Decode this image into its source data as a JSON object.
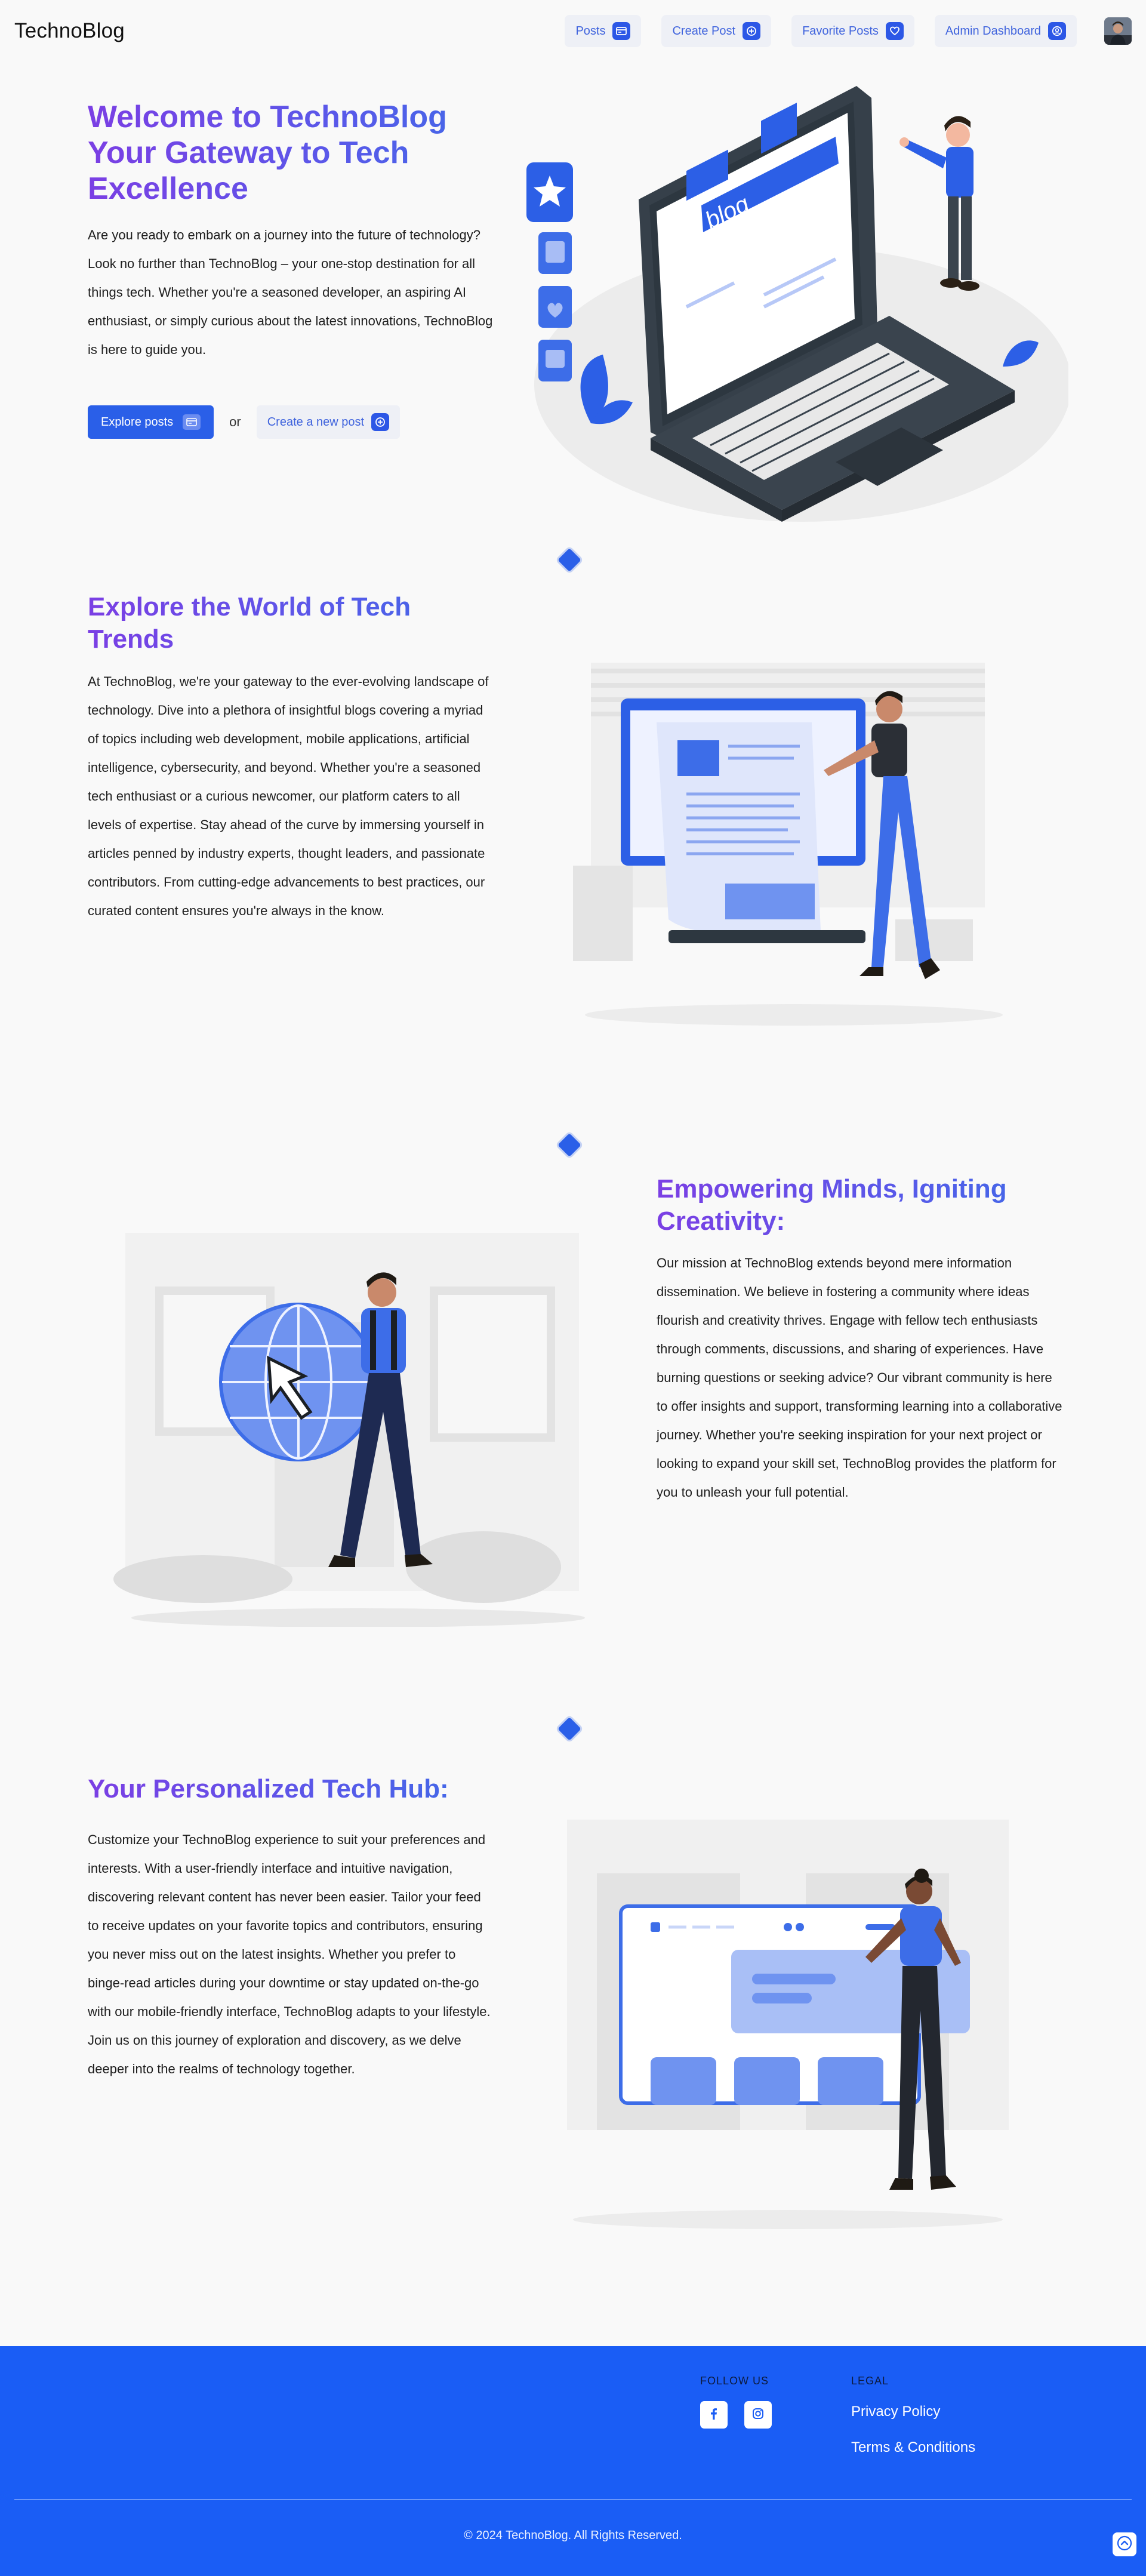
{
  "brand": "TechnoBlog",
  "nav": {
    "posts": "Posts",
    "create_post": "Create Post",
    "favorite_posts": "Favorite Posts",
    "admin_dashboard": "Admin Dashboard"
  },
  "hero": {
    "title_line1": "Welcome to TechnoBlog",
    "title_line2": "Your Gateway to Tech",
    "title_line3": "Excellence",
    "paragraph": "Are you ready to embark on a journey into the future of technology? Look no further than TechnoBlog – your one-stop destination for all things tech. Whether you're a seasoned developer, an aspiring AI enthusiast, or simply curious about the latest innovations, TechnoBlog is here to guide you.",
    "explore_button": "Explore posts",
    "or_text": "or",
    "create_button": "Create a new post",
    "illustration_text": "blog"
  },
  "section2": {
    "title_line1": "Explore the World of Tech",
    "title_line2": "Trends",
    "paragraph": "At TechnoBlog, we're your gateway to the ever-evolving landscape of technology. Dive into a plethora of insightful blogs covering a myriad of topics including web development, mobile applications, artificial intelligence, cybersecurity, and beyond. Whether you're a seasoned tech enthusiast or a curious newcomer, our platform caters to all levels of expertise. Stay ahead of the curve by immersing yourself in articles penned by industry experts, thought leaders, and passionate contributors. From cutting-edge advancements to best practices, our curated content ensures you're always in the know."
  },
  "section3": {
    "title_line1": "Empowering Minds, Igniting",
    "title_line2": "Creativity:",
    "paragraph": "Our mission at TechnoBlog extends beyond mere information dissemination. We believe in fostering a community where ideas flourish and creativity thrives. Engage with fellow tech enthusiasts through comments, discussions, and sharing of experiences. Have burning questions or seeking advice? Our vibrant community is here to offer insights and support, transforming learning into a collaborative journey. Whether you're seeking inspiration for your next project or looking to expand your skill set, TechnoBlog provides the platform for you to unleash your full potential."
  },
  "section4": {
    "title": "Your Personalized Tech Hub:",
    "paragraph": "Customize your TechnoBlog experience to suit your preferences and interests. With a user-friendly interface and intuitive navigation, discovering relevant content has never been easier. Tailor your feed to receive updates on your favorite topics and contributors, ensuring you never miss out on the latest insights. Whether you prefer to binge-read articles during your downtime or stay updated on-the-go with our mobile-friendly interface, TechnoBlog adapts to your lifestyle. Join us on this journey of exploration and discovery, as we delve deeper into the realms of technology together."
  },
  "footer": {
    "follow_us": "FOLLOW US",
    "legal": "LEGAL",
    "privacy_policy": "Privacy Policy",
    "terms": "Terms & Conditions",
    "copyright": "© 2024 TechnoBlog. All Rights Reserved."
  },
  "colors": {
    "accent": "#2a5fe8",
    "footer_bg": "#1a5df5",
    "title_gradient_start": "#7b3fe4",
    "title_gradient_end": "#3d6de8"
  },
  "icons": {
    "posts": "card-icon",
    "create_post": "plus-circle-icon",
    "favorite_posts": "heart-icon",
    "admin_dashboard": "user-circle-icon",
    "facebook": "facebook-icon",
    "instagram": "instagram-icon",
    "back_to_top": "chevron-up-icon"
  }
}
